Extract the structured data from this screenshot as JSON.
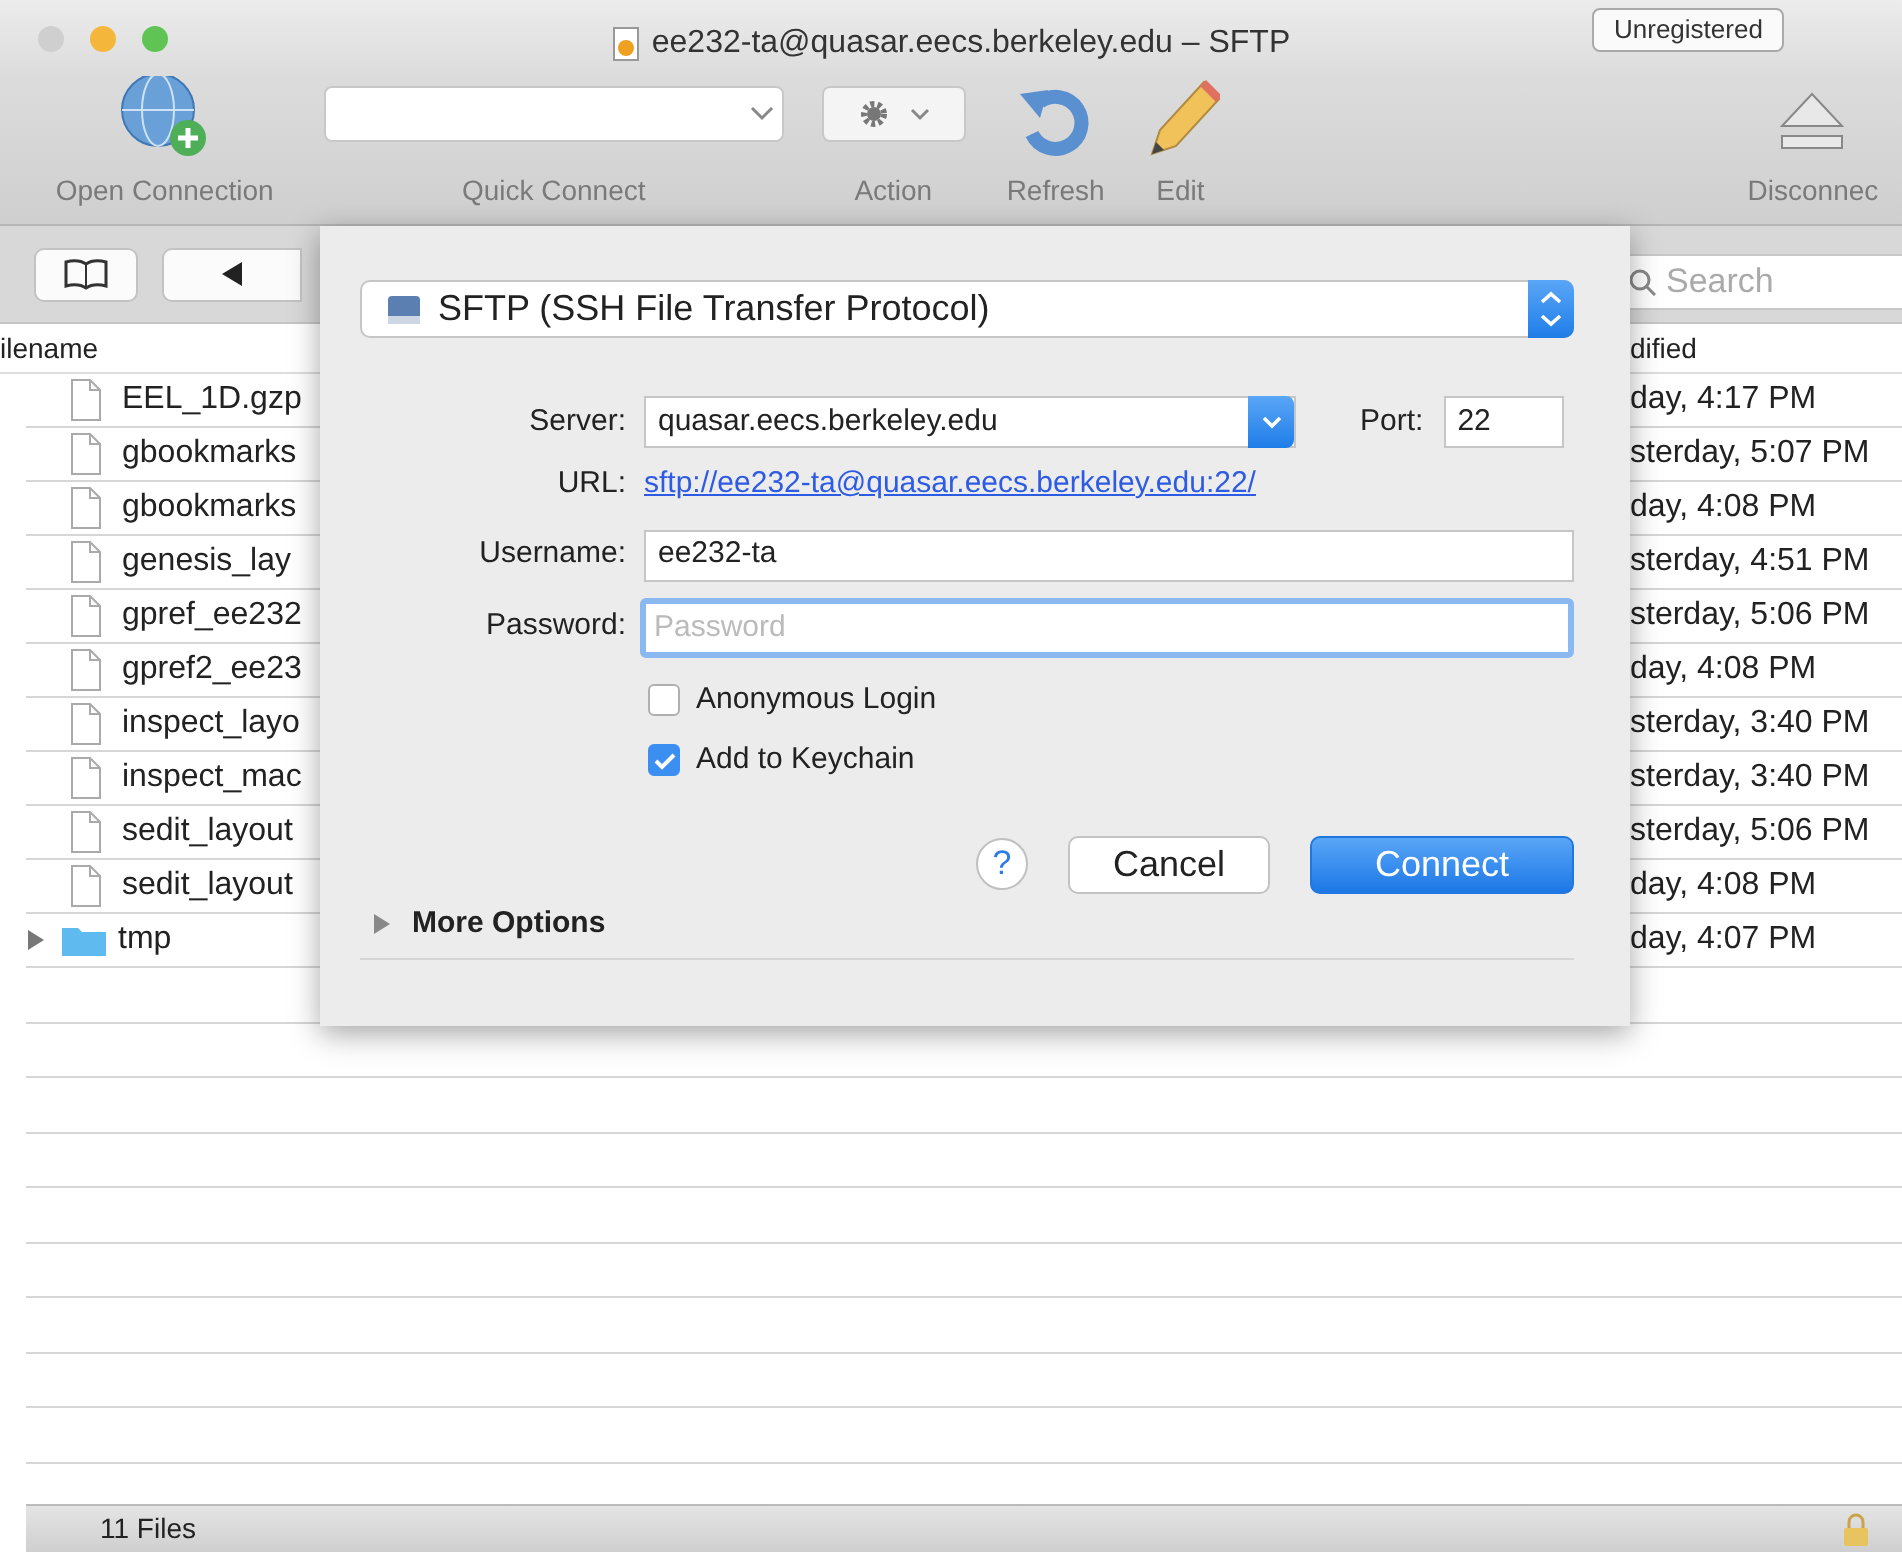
{
  "window": {
    "title": "ee232-ta@quasar.eecs.berkeley.edu – SFTP",
    "badge": "Unregistered"
  },
  "toolbar": [
    {
      "kind": "globe",
      "label": "Open Connection"
    },
    {
      "kind": "combo",
      "label": "Quick Connect"
    },
    {
      "kind": "gear",
      "label": "Action"
    },
    {
      "kind": "refresh",
      "label": "Refresh"
    },
    {
      "kind": "pencil",
      "label": "Edit"
    },
    {
      "kind": "eject",
      "label": "Disconnec"
    }
  ],
  "search": {
    "placeholder": "Search"
  },
  "file_list": {
    "columns": [
      "ilename",
      "dified"
    ],
    "rows": [
      {
        "kind": "file",
        "name": "EEL_1D.gzp",
        "modified": "day, 4:17 PM"
      },
      {
        "kind": "file",
        "name": "gbookmarks",
        "modified": "sterday, 5:07 PM"
      },
      {
        "kind": "file",
        "name": "gbookmarks",
        "modified": "day, 4:08 PM"
      },
      {
        "kind": "file",
        "name": "genesis_lay",
        "modified": "sterday, 4:51 PM"
      },
      {
        "kind": "file",
        "name": "gpref_ee232",
        "modified": "sterday, 5:06 PM"
      },
      {
        "kind": "file",
        "name": "gpref2_ee23",
        "modified": "day, 4:08 PM"
      },
      {
        "kind": "file",
        "name": "inspect_layo",
        "modified": "sterday, 3:40 PM"
      },
      {
        "kind": "file",
        "name": "inspect_mac",
        "modified": "sterday, 3:40 PM"
      },
      {
        "kind": "file",
        "name": "sedit_layout",
        "modified": "sterday, 5:06 PM"
      },
      {
        "kind": "file",
        "name": "sedit_layout",
        "modified": "day, 4:08 PM"
      },
      {
        "kind": "folder",
        "name": "tmp",
        "modified": "day, 4:07 PM"
      }
    ]
  },
  "dialog": {
    "protocol": "SFTP (SSH File Transfer Protocol)",
    "server_label": "Server:",
    "server": "quasar.eecs.berkeley.edu",
    "port_label": "Port:",
    "port": "22",
    "url_label": "URL:",
    "url": "sftp://ee232-ta@quasar.eecs.berkeley.edu:22/",
    "username_label": "Username:",
    "username": "ee232-ta",
    "password_label": "Password:",
    "password_placeholder": "Password",
    "checkboxes": [
      {
        "label": "Anonymous Login",
        "checked": false
      },
      {
        "label": "Add to Keychain",
        "checked": true
      }
    ],
    "help": "?",
    "cancel": "Cancel",
    "connect": "Connect",
    "more_options": {
      "label": "More Options",
      "expanded": false
    }
  },
  "status_bar": {
    "text": "11 Files"
  }
}
